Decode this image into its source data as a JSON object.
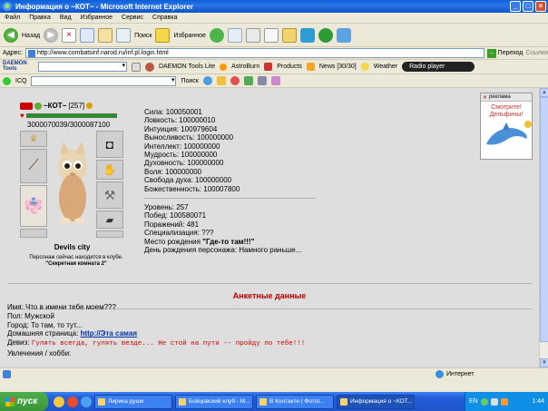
{
  "window": {
    "title": "Информация о ~КОТ~ - Microsoft Internet Explorer"
  },
  "menu": [
    "Файл",
    "Правка",
    "Вид",
    "Избранное",
    "Сервис",
    "Справка"
  ],
  "toolbar": {
    "back": "Назад",
    "search": "Поиск",
    "favorites": "Избранное"
  },
  "address": {
    "label": "Адрес:",
    "url": "http://www.combatsinf.narod.ru/inf.pl.login.html",
    "go": "Переход",
    "links": "Ссылки"
  },
  "daemonbar": {
    "logo": "DAEMON Tools",
    "daemon_tools_lite": "DAEMON Tools Lite",
    "astroburn": "AstroBurn",
    "products": "Products",
    "news": "News [30/30]",
    "weather": "Weather",
    "radio": "Radio player"
  },
  "icqbar": {
    "icq": "ICQ",
    "search": "Поиск"
  },
  "character": {
    "nick": "~КОТ~",
    "level": "[257]",
    "hp_text": "3000070039/3000087100",
    "hp_fraction": 0.9999,
    "city": "Devils city",
    "club_line1": "Персонаж сейчас находится в клубе.",
    "club_line2": "\"Секретная комната 2\""
  },
  "stats": {
    "attributes": [
      "Сила: 100050001",
      "Ловкость: 100000010",
      "Интуиция: 100979604",
      "Выносливость: 100000000",
      "Интеллект: 100000000",
      "Мудрость: 100000000",
      "Духовность: 100000000",
      "Воля: 100000000",
      "Свобода духа: 100000000",
      "Божественность: 100007800"
    ],
    "info": [
      "Уровень: 257",
      "Побед: 100580071",
      "Поражений: 481",
      "Специализация: ???"
    ],
    "birthplace_label": "Место рождения ",
    "birthplace_value": "\"Где-то там!!!\"",
    "birthday": "День рождения персонажа: Намного раньше..."
  },
  "anketa": {
    "title": "Анкетные данные",
    "name": "Имя: Что в имени тебе моем???",
    "sex": "Пол: Мужской",
    "city": "Город: То там, то тут...",
    "homepage_label": "Домашняя страница: ",
    "homepage_link": "http://Эта самая",
    "motto_label": "Девиз: ",
    "motto": "Гулять всегда, гулять везде... Не стой на пути -- пройду по тебе!!!",
    "hobby": "Увлечения / хобби:"
  },
  "ad": {
    "label": "реклама",
    "text_line1": "Смотрите!",
    "text_line2": "Дельфины!"
  },
  "status": {
    "zone": "Интернет"
  },
  "taskbar": {
    "start": "пуск",
    "tasks": [
      "Лирика души",
      "Бойцовский клуб - М...",
      "В Контакте | Фотог...",
      "Информация о ~КОТ..."
    ],
    "lang": "EN",
    "clock": "1:44"
  }
}
